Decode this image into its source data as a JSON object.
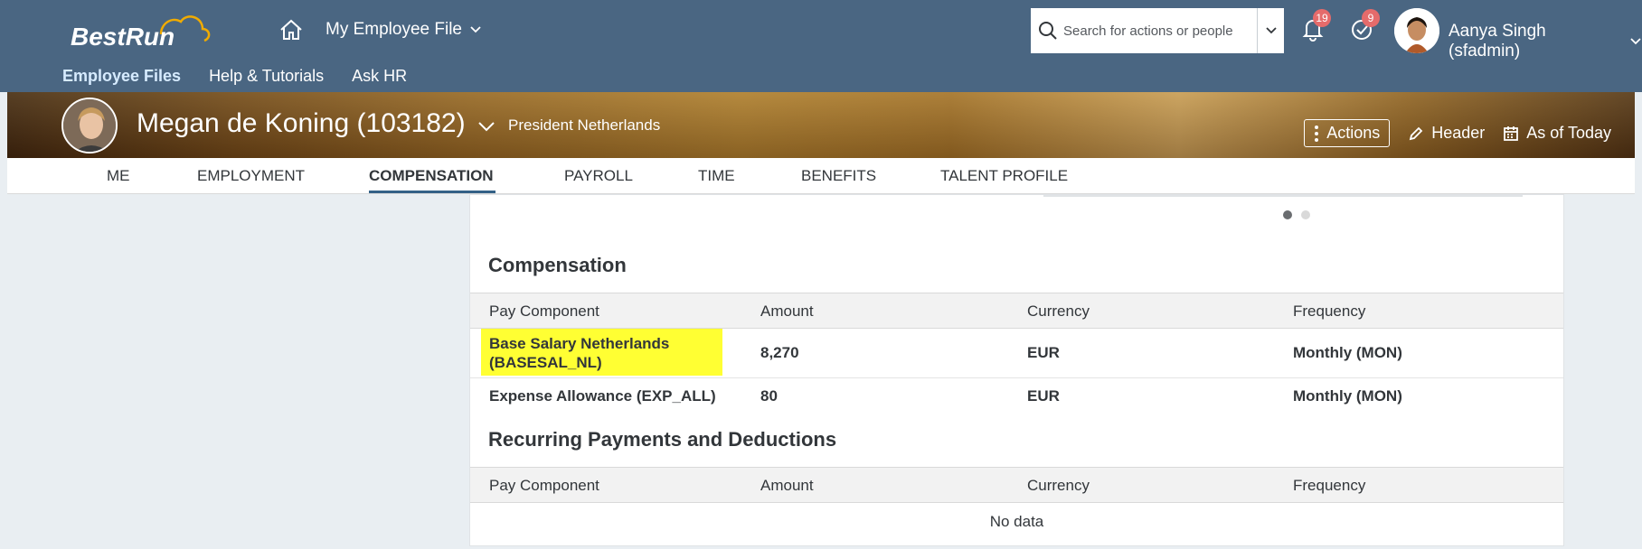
{
  "shell": {
    "logo_text": "BestRun",
    "nav_title": "My Employee File",
    "search_placeholder": "Search for actions or people",
    "notifications_count": "19",
    "tasks_count": "9",
    "user_name": "Aanya Singh (sfadmin)",
    "subnav": [
      "Employee Files",
      "Help & Tutorials",
      "Ask HR"
    ]
  },
  "header": {
    "employee_name": "Megan de Koning (103182)",
    "position": "President Netherlands",
    "actions_label": "Actions",
    "header_label": "Header",
    "date_label": "As of Today"
  },
  "tabs": [
    "ME",
    "EMPLOYMENT",
    "COMPENSATION",
    "PAYROLL",
    "TIME",
    "BENEFITS",
    "TALENT PROFILE"
  ],
  "compensation": {
    "title": "Compensation",
    "columns": [
      "Pay Component",
      "Amount",
      "Currency",
      "Frequency"
    ],
    "rows": [
      {
        "component_line1": "Base Salary Netherlands",
        "component_line2": "(BASESAL_NL)",
        "amount": "8,270",
        "currency": "EUR",
        "frequency": "Monthly (MON)"
      },
      {
        "component_line1": "Expense Allowance (EXP_ALL)",
        "amount": "80",
        "currency": "EUR",
        "frequency": "Monthly (MON)"
      }
    ]
  },
  "recurring": {
    "title": "Recurring Payments and Deductions",
    "columns": [
      "Pay Component",
      "Amount",
      "Currency",
      "Frequency"
    ],
    "empty_text": "No data"
  },
  "colors": {
    "shell": "#4a6682",
    "highlight": "#ffff33",
    "badge": "#e56b6b"
  }
}
